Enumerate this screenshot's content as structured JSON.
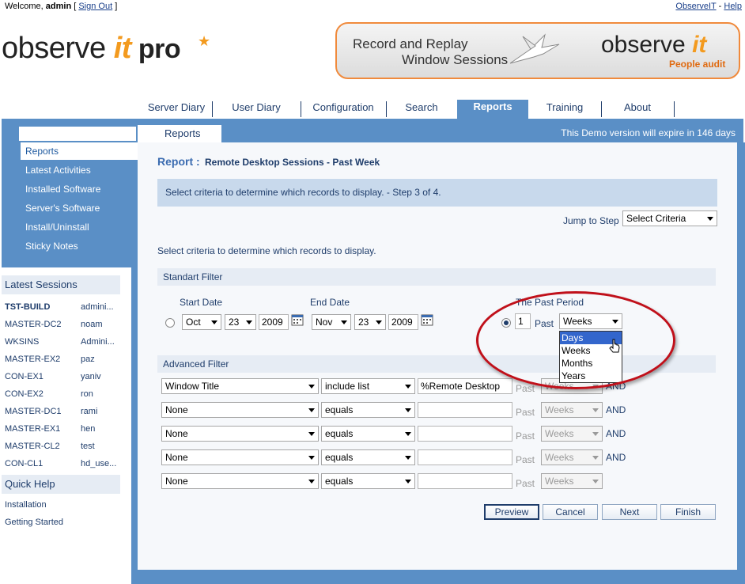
{
  "header": {
    "welcome_prefix": "Welcome,",
    "user": "admin",
    "sign_out": "Sign Out",
    "observeit_link": "ObserveIT",
    "separator": "-",
    "help_link": "Help"
  },
  "logo": {
    "word1": "observe ",
    "word2": "it",
    "word3": " pro",
    "star": "★"
  },
  "banner": {
    "line1": "Record and Replay",
    "line2": "Window Sessions",
    "brand1": "observe ",
    "brand2": "it",
    "sub": "People audit"
  },
  "nav": {
    "tabs": [
      "Server Diary",
      "User Diary",
      "Configuration",
      "Search",
      "Reports",
      "Training",
      "About"
    ],
    "active": "Reports"
  },
  "subnav": {
    "tab": "Reports",
    "expire": "This Demo version will expire in 146 days"
  },
  "sidebar": {
    "menu": [
      "Reports",
      "Latest Activities",
      "Installed Software",
      "Server's Software",
      "Install/Uninstall",
      "Sticky Notes"
    ],
    "latest_sessions_title": "Latest Sessions",
    "sessions": [
      {
        "host": "TST-BUILD",
        "user": "admini..."
      },
      {
        "host": "MASTER-DC2",
        "user": "noam"
      },
      {
        "host": "WKSINS",
        "user": "Admini..."
      },
      {
        "host": "MASTER-EX2",
        "user": "paz"
      },
      {
        "host": "CON-EX1",
        "user": "yaniv"
      },
      {
        "host": "CON-EX2",
        "user": "ron"
      },
      {
        "host": "MASTER-DC1",
        "user": "rami"
      },
      {
        "host": "MASTER-EX1",
        "user": "hen"
      },
      {
        "host": "MASTER-CL2",
        "user": "test"
      },
      {
        "host": "CON-CL1",
        "user": "hd_use..."
      }
    ],
    "quick_help_title": "Quick Help",
    "quick_help": [
      "Installation",
      "Getting Started"
    ]
  },
  "report": {
    "title": "Report :",
    "subtitle": "Remote Desktop Sessions - Past Week",
    "step_text": "Select criteria to determine which records to display. - Step 3 of 4.",
    "jump_label": "Jump to Step",
    "jump_value": "Select Criteria",
    "criteria_text": "Select criteria to determine which records to display."
  },
  "standard_filter": {
    "title": "Standart Filter",
    "start_label": "Start Date",
    "start_month": "Oct",
    "start_day": "23",
    "start_year": "2009",
    "end_label": "End Date",
    "end_month": "Nov",
    "end_day": "23",
    "end_year": "2009",
    "past_period_label": "The Past Period",
    "past_count": "1",
    "past_word": "Past",
    "past_unit": "Weeks",
    "unit_options": [
      "Days",
      "Weeks",
      "Months",
      "Years"
    ],
    "highlighted_option": "Days"
  },
  "advanced_filter": {
    "title": "Advanced Filter",
    "rows": [
      {
        "field": "Window Title",
        "op": "include list",
        "value": "%Remote Desktop",
        "past": "Past",
        "unit": "Weeks",
        "and": "AND"
      },
      {
        "field": "None",
        "op": "equals",
        "value": "",
        "past": "Past",
        "unit": "Weeks",
        "and": "AND"
      },
      {
        "field": "None",
        "op": "equals",
        "value": "",
        "past": "Past",
        "unit": "Weeks",
        "and": "AND"
      },
      {
        "field": "None",
        "op": "equals",
        "value": "",
        "past": "Past",
        "unit": "Weeks",
        "and": "AND"
      },
      {
        "field": "None",
        "op": "equals",
        "value": "",
        "past": "Past",
        "unit": "Weeks",
        "and": ""
      }
    ]
  },
  "buttons": {
    "preview": "Preview",
    "cancel": "Cancel",
    "next": "Next",
    "finish": "Finish"
  },
  "colors": {
    "frame_blue": "#5a8fc6",
    "accent_orange": "#f39a1e",
    "highlight_red": "#c0101a"
  }
}
